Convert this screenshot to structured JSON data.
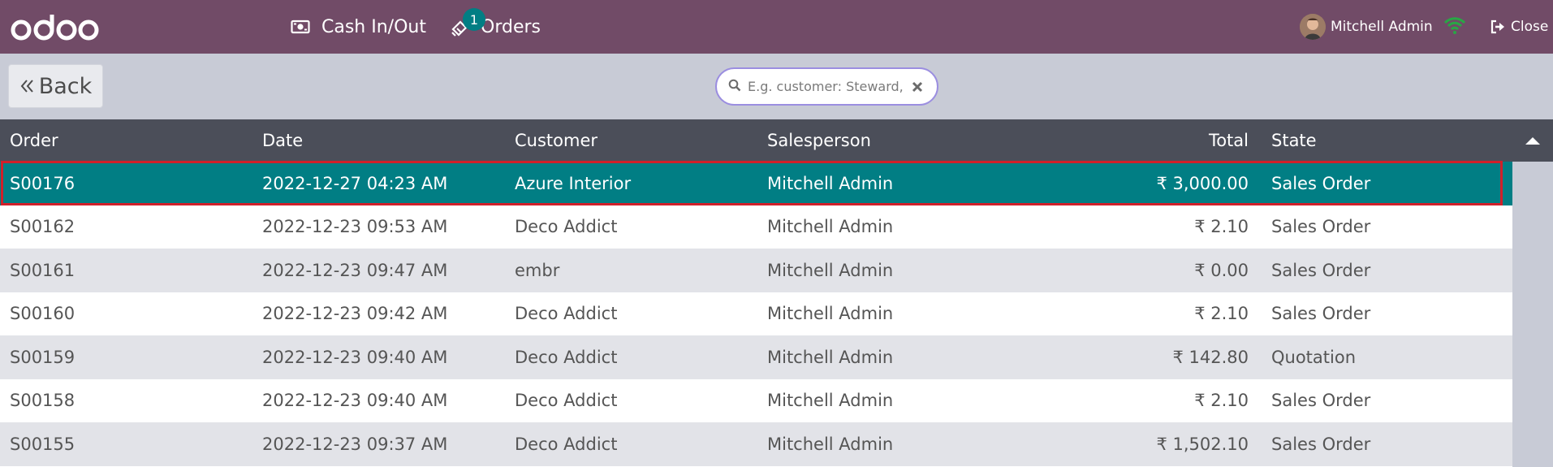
{
  "brand": {
    "logo_text": "odoo"
  },
  "navbar": {
    "cash_label": "Cash In/Out",
    "orders_label": "Orders",
    "orders_badge": "1",
    "user_name": "Mitchell Admin",
    "close_label": "Close"
  },
  "controls": {
    "back_label": "Back",
    "search_placeholder": "E.g. customer: Steward, d"
  },
  "table": {
    "headers": {
      "order": "Order",
      "date": "Date",
      "customer": "Customer",
      "salesperson": "Salesperson",
      "total": "Total",
      "state": "State"
    },
    "rows": [
      {
        "order": "S00176",
        "date": "2022-12-27 04:23 AM",
        "customer": "Azure Interior",
        "salesperson": "Mitchell Admin",
        "total": "₹ 3,000.00",
        "state": "Sales Order"
      },
      {
        "order": "S00162",
        "date": "2022-12-23 09:53 AM",
        "customer": "Deco Addict",
        "salesperson": "Mitchell Admin",
        "total": "₹ 2.10",
        "state": "Sales Order"
      },
      {
        "order": "S00161",
        "date": "2022-12-23 09:47 AM",
        "customer": "embr",
        "salesperson": "Mitchell Admin",
        "total": "₹ 0.00",
        "state": "Sales Order"
      },
      {
        "order": "S00160",
        "date": "2022-12-23 09:42 AM",
        "customer": "Deco Addict",
        "salesperson": "Mitchell Admin",
        "total": "₹ 2.10",
        "state": "Sales Order"
      },
      {
        "order": "S00159",
        "date": "2022-12-23 09:40 AM",
        "customer": "Deco Addict",
        "salesperson": "Mitchell Admin",
        "total": "₹ 142.80",
        "state": "Quotation"
      },
      {
        "order": "S00158",
        "date": "2022-12-23 09:40 AM",
        "customer": "Deco Addict",
        "salesperson": "Mitchell Admin",
        "total": "₹ 2.10",
        "state": "Sales Order"
      },
      {
        "order": "S00155",
        "date": "2022-12-23 09:37 AM",
        "customer": "Deco Addict",
        "salesperson": "Mitchell Admin",
        "total": "₹ 1,502.10",
        "state": "Sales Order"
      }
    ]
  },
  "colors": {
    "navbar": "#714B67",
    "selected_row": "#017e84",
    "header_row": "#4b4e59",
    "highlight_outline": "#d0202a",
    "badge": "#017e84"
  }
}
